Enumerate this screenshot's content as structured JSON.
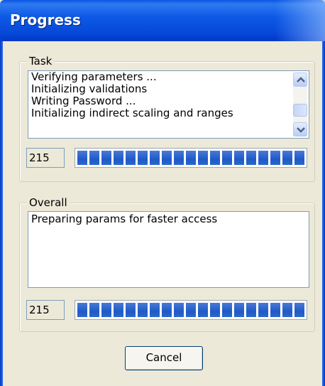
{
  "window": {
    "title": "Progress"
  },
  "task": {
    "label": "Task",
    "lines": [
      "Verifying parameters ...",
      "Initializing validations",
      "Writing Password ...",
      "Initializing indirect scaling and ranges"
    ],
    "counter": "215",
    "progress_percent": 100
  },
  "overall": {
    "label": "Overall",
    "lines": [
      "Preparing params for faster access"
    ],
    "counter": "215",
    "progress_percent": 100
  },
  "actions": {
    "cancel_label": "Cancel"
  },
  "colors": {
    "titlebar": "#0A56E4",
    "progress_block": "#1E5BC6",
    "dialog_bg": "#ECE9D8"
  },
  "icons": {
    "scroll_up": "chevron-up-icon",
    "scroll_down": "chevron-down-icon"
  }
}
